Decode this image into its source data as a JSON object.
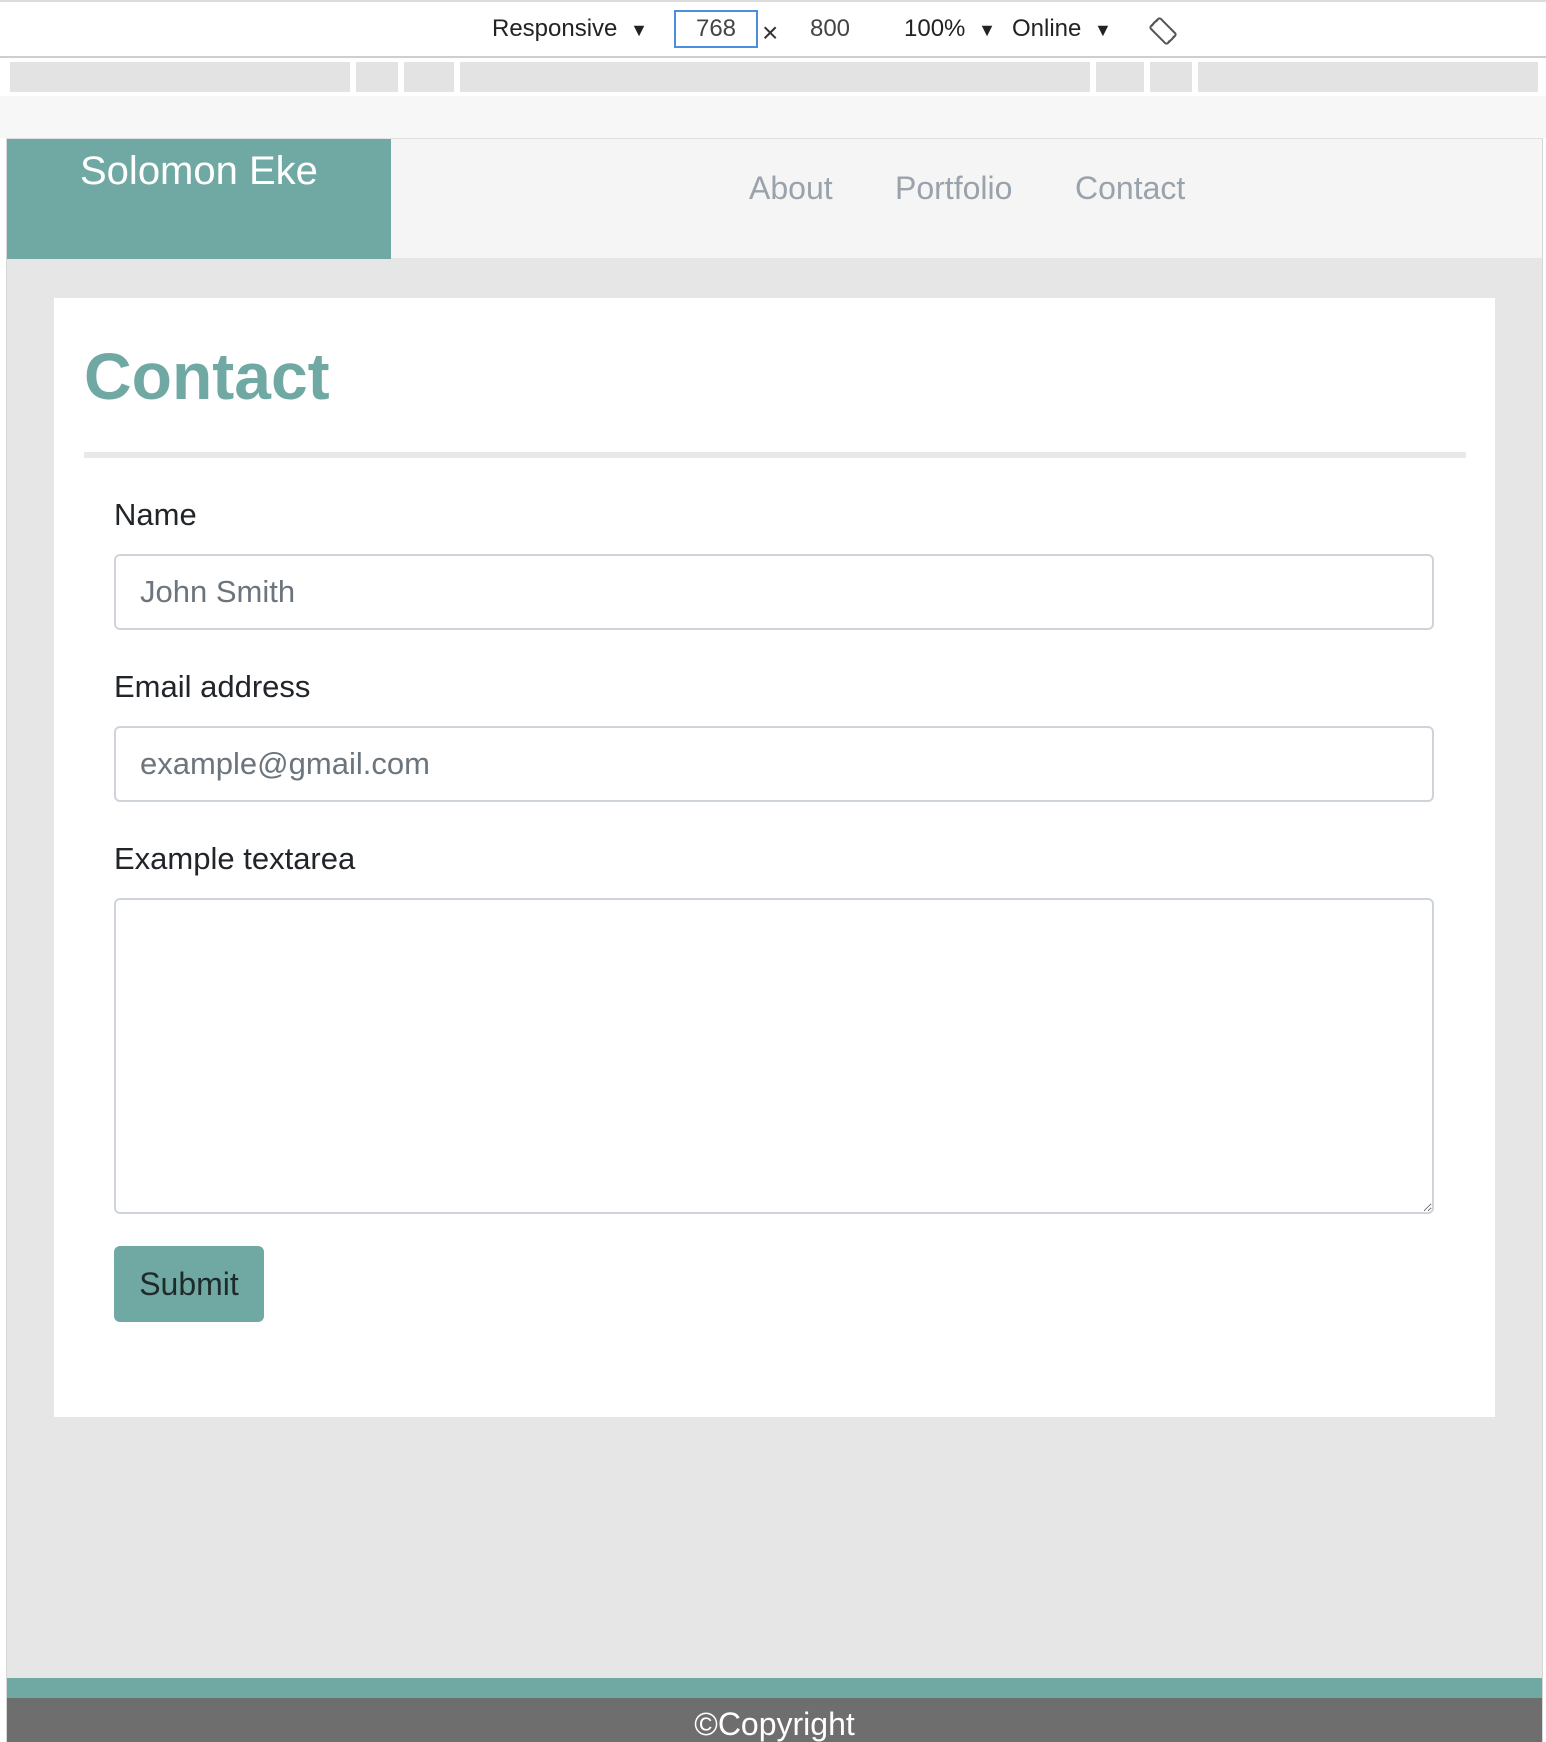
{
  "devtools": {
    "device_mode": "Responsive",
    "width": "768",
    "times": "×",
    "height": "800",
    "zoom": "100%",
    "throttle": "Online",
    "dropdown_glyph": "▼",
    "rotate_icon": "rotate-icon"
  },
  "navbar": {
    "brand": "Solomon Eke",
    "links": [
      "About",
      "Portfolio",
      "Contact"
    ]
  },
  "contact_form": {
    "title": "Contact",
    "name": {
      "label": "Name",
      "placeholder": "John Smith",
      "value": ""
    },
    "email": {
      "label": "Email address",
      "placeholder": "example@gmail.com",
      "value": ""
    },
    "message": {
      "label": "Example textarea",
      "value": ""
    },
    "submit_label": "Submit"
  },
  "footer": {
    "text": "©Copyright"
  },
  "colors": {
    "accent": "#70a9a3",
    "navbar_bg": "#f5f5f5",
    "page_bg": "#e6e6e6",
    "footer_bg": "#6e6e6e",
    "nav_link": "#9aa2ab"
  }
}
